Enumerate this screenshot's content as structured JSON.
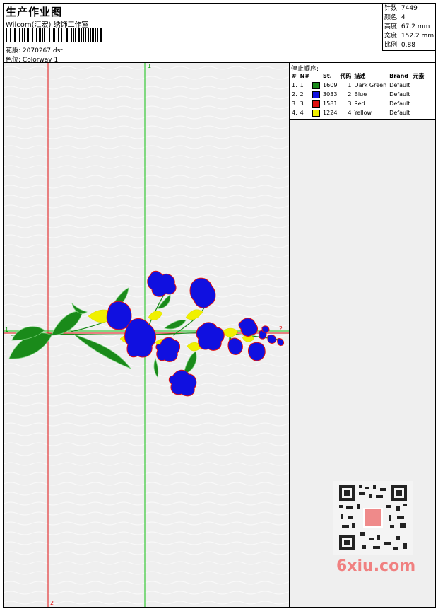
{
  "header": {
    "title": "生产作业图",
    "company": "Wilcom(汇宏) 绣饰工作室",
    "design_label": "花版:",
    "design_value": "2070267.dst",
    "colorway_label": "色位:",
    "colorway_value": "Colorway 1"
  },
  "stats": [
    {
      "label": "针数:",
      "value": "7449"
    },
    {
      "label": "颜色:",
      "value": "4"
    },
    {
      "label": "高度:",
      "value": "67.2 mm"
    },
    {
      "label": "宽度:",
      "value": "152.2 mm"
    },
    {
      "label": "比例:",
      "value": "0.88"
    }
  ],
  "stop_sequence": {
    "title": "停止顺序:",
    "columns": [
      "#",
      "N#",
      "St.",
      "代码",
      "描述",
      "Brand",
      "元素"
    ],
    "rows": [
      {
        "idx": "1.",
        "n": "1",
        "color": "#1a8a1a",
        "st": "1609",
        "code": "1",
        "desc": "Dark Green",
        "brand": "Default"
      },
      {
        "idx": "2.",
        "n": "2",
        "color": "#1010e0",
        "st": "3033",
        "code": "2",
        "desc": "Blue",
        "brand": "Default"
      },
      {
        "idx": "3.",
        "n": "3",
        "color": "#e01010",
        "st": "1581",
        "code": "3",
        "desc": "Red",
        "brand": "Default"
      },
      {
        "idx": "4.",
        "n": "4",
        "color": "#f0f000",
        "st": "1224",
        "code": "4",
        "desc": "Yellow",
        "brand": "Default"
      }
    ]
  },
  "guides": {
    "green_v": "1",
    "red_v": "2",
    "green_h": "1",
    "red_h": "2"
  },
  "watermark": "6xiu.com",
  "colors": {
    "green": "#1a8a1a",
    "blue": "#1010e0",
    "red": "#e01010",
    "yellow": "#f0f000"
  }
}
